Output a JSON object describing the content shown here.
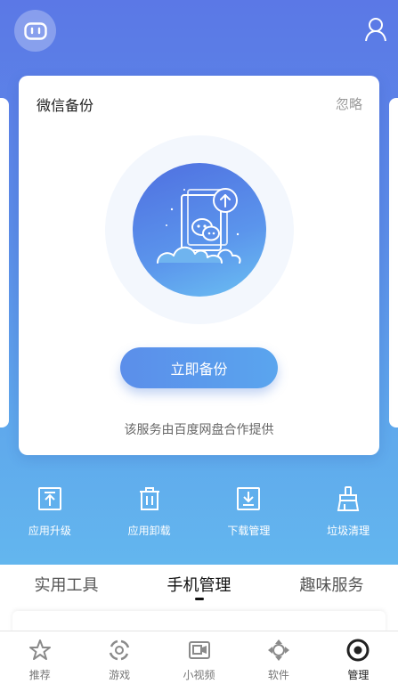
{
  "header": {
    "robot_icon": "robot-icon",
    "user_icon": "user-icon"
  },
  "card": {
    "title": "微信备份",
    "ignore_label": "忽略",
    "backup_button": "立即备份",
    "provider_text": "该服务由百度网盘合作提供"
  },
  "tools": [
    {
      "label": "应用升级",
      "icon": "upgrade-icon"
    },
    {
      "label": "应用卸载",
      "icon": "trash-icon"
    },
    {
      "label": "下载管理",
      "icon": "download-icon"
    },
    {
      "label": "垃圾清理",
      "icon": "broom-icon"
    }
  ],
  "tabs": [
    {
      "label": "实用工具"
    },
    {
      "label": "手机管理",
      "active": true
    },
    {
      "label": "趣味服务"
    }
  ],
  "bottom_nav": [
    {
      "label": "推荐",
      "icon": "star-icon"
    },
    {
      "label": "游戏",
      "icon": "game-icon"
    },
    {
      "label": "小视频",
      "icon": "video-icon"
    },
    {
      "label": "软件",
      "icon": "software-icon"
    },
    {
      "label": "管理",
      "icon": "manage-icon",
      "active": true
    }
  ],
  "colors": {
    "accent": "#5b8eea",
    "hero_top": "#5b78e6",
    "hero_bottom": "#63b6ee"
  }
}
